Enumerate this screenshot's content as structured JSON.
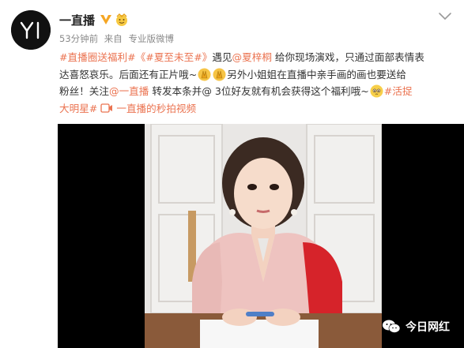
{
  "user": {
    "name": "一直播",
    "avatar_text": "Yi"
  },
  "meta": {
    "time": "53分钟前",
    "source_prefix": "来自",
    "source": "专业版微博"
  },
  "post": {
    "line1": {
      "hashtag1": "#直播圈送福利#",
      "title": "《#夏至未至#》",
      "text_a": "遇见",
      "mention": "@夏梓桐",
      "text_b": " 给你现场演戏，只通过面部表情表"
    },
    "line2": {
      "text_a": "达喜怒哀乐。后面还有正片哦~",
      "text_b": "另外小姐姐在直播中亲手画的画也要送给"
    },
    "line3": {
      "text_a": "粉丝！关注",
      "mention": "@一直播",
      "text_b": " 转发本条并@ 3位好友就有机会获得这个福利哦~",
      "hashtag": "#活捉"
    },
    "line4": {
      "hashtag": "大明星#",
      "video_link": "一直播的秒拍视频"
    }
  },
  "watermark": {
    "text": "今日网红"
  },
  "colors": {
    "link": "#eb7350",
    "meta": "#8a8a8a",
    "text": "#333333"
  },
  "icons": {
    "verified": "verified-v-icon",
    "badge": "member-badge-icon",
    "dropdown": "chevron-down-icon",
    "video_link": "video-link-icon",
    "watermark": "wechat-icon"
  }
}
